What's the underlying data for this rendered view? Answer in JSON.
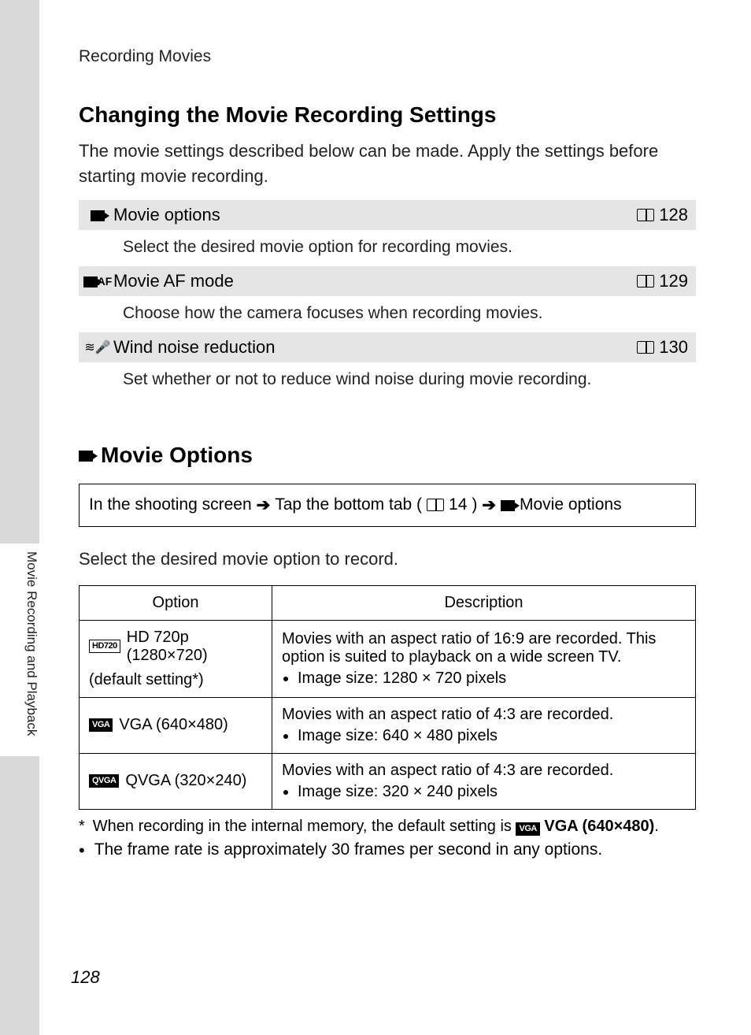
{
  "breadcrumb": "Recording Movies",
  "heading1": "Changing the Movie Recording Settings",
  "intro": "The movie settings described below can be made. Apply the settings before starting movie recording.",
  "settings": [
    {
      "icon": "movie-icon",
      "title": "Movie options",
      "page": "128",
      "desc": "Select the desired movie option for recording movies."
    },
    {
      "icon": "movie-af-icon",
      "title": "Movie AF mode",
      "page": "129",
      "desc": "Choose how the camera focuses when recording movies."
    },
    {
      "icon": "wind-icon",
      "title": "Wind noise reduction",
      "page": "130",
      "desc": "Set whether or not to reduce wind noise during movie recording."
    }
  ],
  "heading2": "Movie Options",
  "navPath": {
    "part1": "In the shooting screen",
    "part2": "Tap the bottom tab (",
    "navPage": "14",
    "part3": ")",
    "part4": "Movie options"
  },
  "lead": "Select the desired movie option to record.",
  "table": {
    "headers": [
      "Option",
      "Description"
    ],
    "rows": [
      {
        "badge": "HD720",
        "badgeInv": false,
        "name": "HD 720p (1280×720)",
        "sub": "(default setting*)",
        "desc": "Movies with an aspect ratio of 16:9 are recorded. This option is suited to playback on a wide screen TV.",
        "bullet": "Image size: 1280 × 720 pixels"
      },
      {
        "badge": "VGA",
        "badgeInv": true,
        "name": "VGA (640×480)",
        "sub": "",
        "desc": "Movies with an aspect ratio of 4:3 are recorded.",
        "bullet": "Image size: 640 × 480 pixels"
      },
      {
        "badge": "QVGA",
        "badgeInv": true,
        "name": "QVGA (320×240)",
        "sub": "",
        "desc": "Movies with an aspect ratio of 4:3 are recorded.",
        "bullet": "Image size: 320 × 240 pixels"
      }
    ]
  },
  "footnote": {
    "marker": "*",
    "textA": "When recording in the internal memory, the default setting is",
    "badge": "VGA",
    "textB": "VGA (640×480)",
    "textC": "."
  },
  "noteBullet": "The frame rate is approximately 30 frames per second in any options.",
  "sideLabel": "Movie Recording and Playback",
  "pageNum": "128"
}
